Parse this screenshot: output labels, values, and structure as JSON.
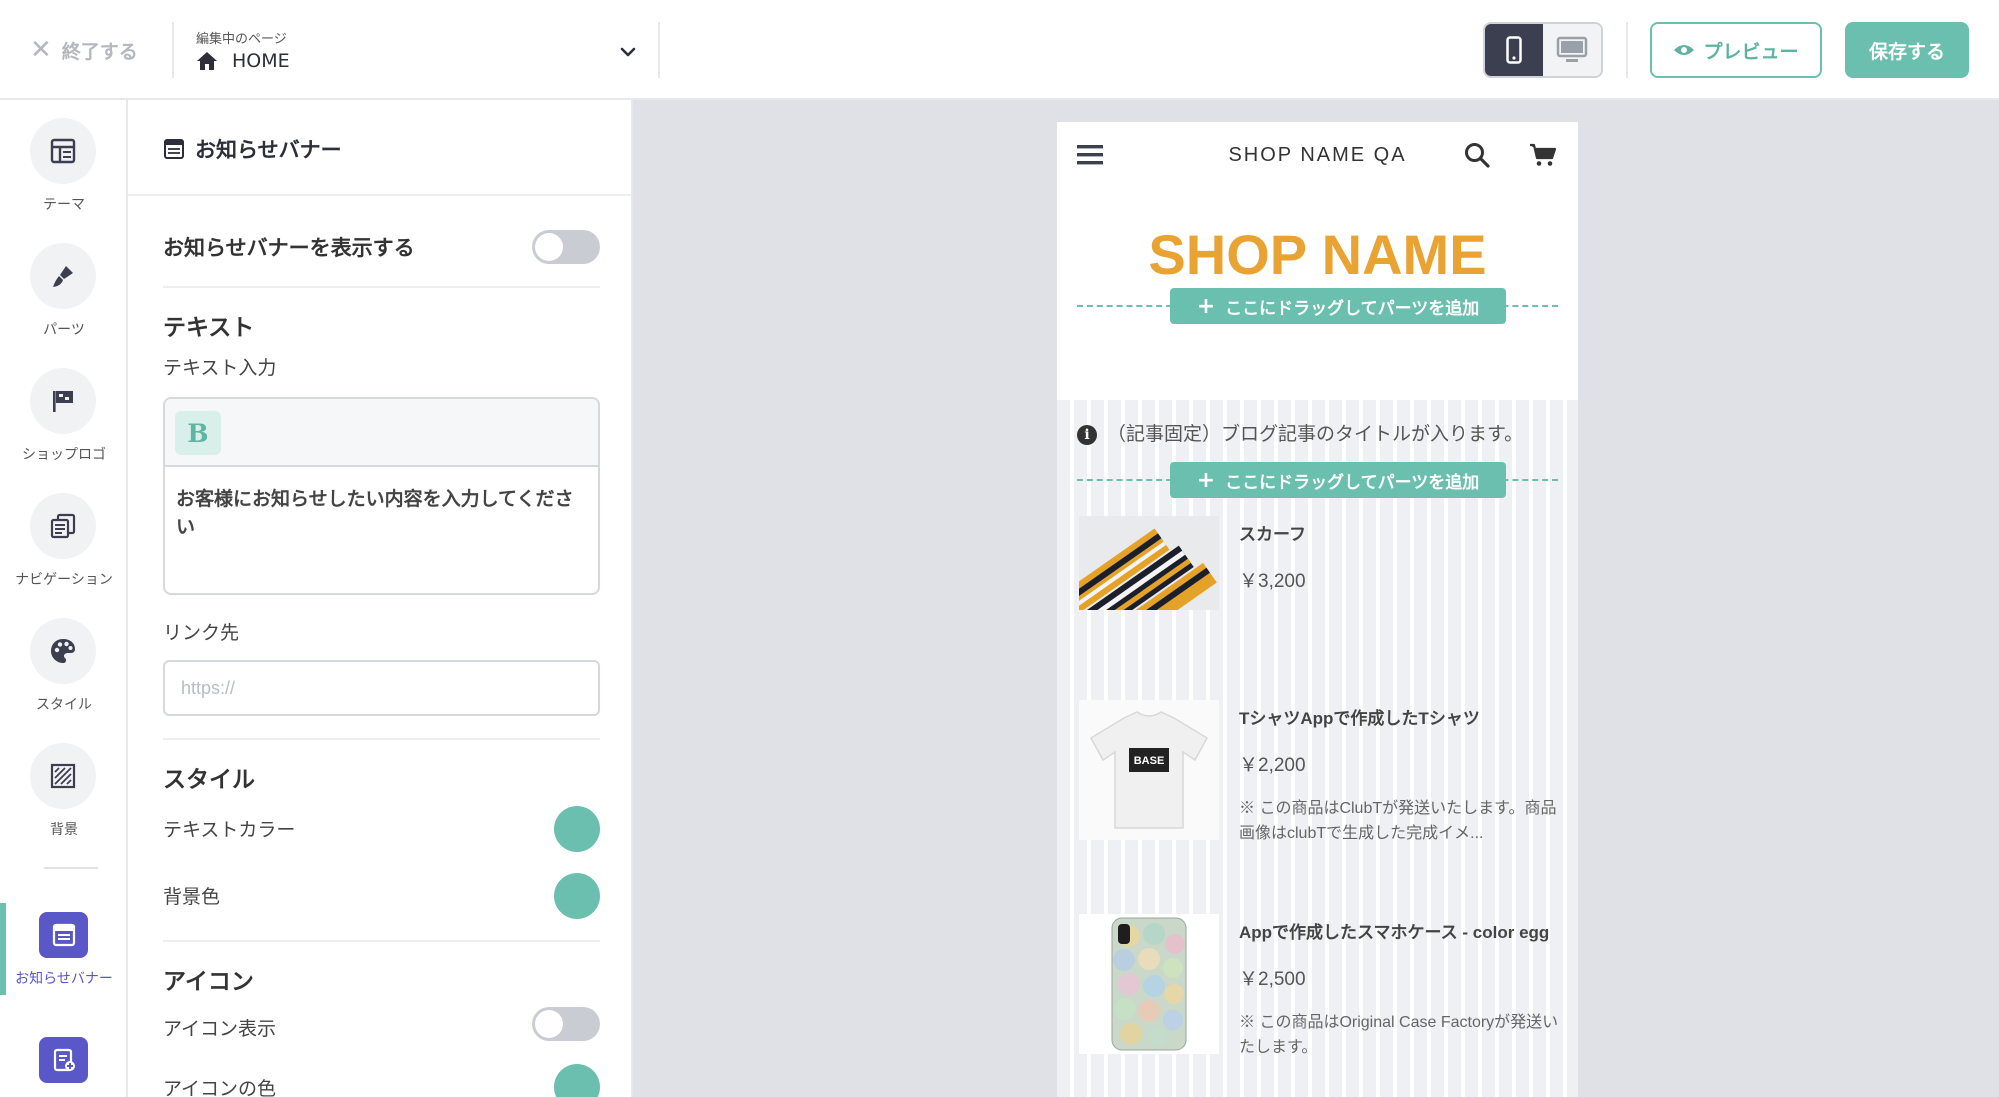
{
  "topbar": {
    "exit_label": "終了する",
    "page_caption": "編集中のページ",
    "page_name": "HOME",
    "preview_label": "プレビュー",
    "save_label": "保存する"
  },
  "rail": {
    "items": [
      {
        "label": "テーマ",
        "icon": "layout-icon"
      },
      {
        "label": "パーツ",
        "icon": "brush-icon"
      },
      {
        "label": "ショップロゴ",
        "icon": "flag-icon"
      },
      {
        "label": "ナビゲーション",
        "icon": "navigation-icon"
      },
      {
        "label": "スタイル",
        "icon": "palette-icon"
      },
      {
        "label": "背景",
        "icon": "hatched-square-icon"
      },
      {
        "label": "お知らせバナー",
        "icon": "banner-icon"
      }
    ]
  },
  "panel": {
    "title": "お知らせバナー",
    "show_banner_label": "お知らせバナーを表示する",
    "show_banner_on": false,
    "text_section": "テキスト",
    "text_input_label": "テキスト入力",
    "bold_label": "B",
    "editor_text": "お客様にお知らせしたい内容を入力してください",
    "link_label": "リンク先",
    "link_placeholder": "https://",
    "style_section": "スタイル",
    "text_color_label": "テキストカラー",
    "text_color": "#6bbfae",
    "bg_color_label": "背景色",
    "bg_color": "#6bbfae",
    "icon_section": "アイコン",
    "icon_display_label": "アイコン表示",
    "icon_display_on": false,
    "icon_color_label": "アイコンの色",
    "icon_color": "#6bbfae"
  },
  "preview": {
    "shop_name_small": "SHOP NAME QA",
    "shop_name_logo": "SHOP NAME",
    "dropzone_label": "ここにドラッグしてパーツを追加",
    "blog_text": "（記事固定）ブログ記事のタイトルが入ります。",
    "products": [
      {
        "name": "スカーフ",
        "price": "￥3,200",
        "note": ""
      },
      {
        "name": "TシャツAppで作成したTシャツ",
        "price": "￥2,200",
        "note": "※ この商品はClubTが発送いたします。商品画像はclubTで生成した完成イメ..."
      },
      {
        "name": "Appで作成したスマホケース - color egg",
        "price": "￥2,500",
        "note": "※ この商品はOriginal Case Factoryが発送いたします。"
      }
    ],
    "tshirt_print": "BASE"
  },
  "colors": {
    "accent": "#6bbfae",
    "logo": "#e8a333",
    "rail_active": "#5a58c9",
    "dark": "#3b3f4f"
  }
}
